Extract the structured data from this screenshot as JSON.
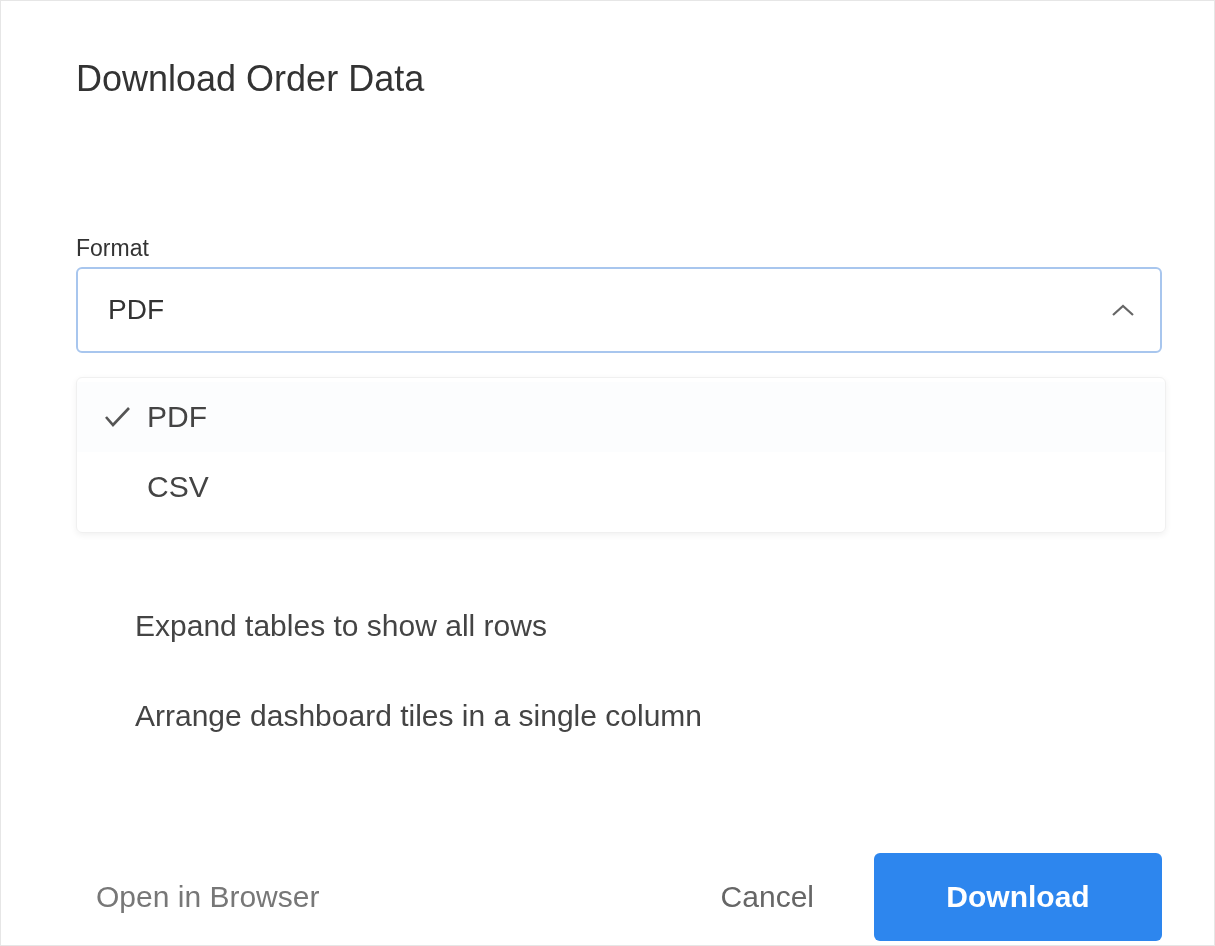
{
  "dialog": {
    "title": "Download Order Data"
  },
  "format": {
    "label": "Format",
    "value": "PDF",
    "expanded": true,
    "options": [
      {
        "label": "PDF",
        "selected": true
      },
      {
        "label": "CSV",
        "selected": false
      }
    ]
  },
  "options": [
    "Expand tables to show all rows",
    "Arrange dashboard tiles in a single column"
  ],
  "buttons": {
    "link": "Open in Browser",
    "cancel": "Cancel",
    "primary": "Download"
  }
}
